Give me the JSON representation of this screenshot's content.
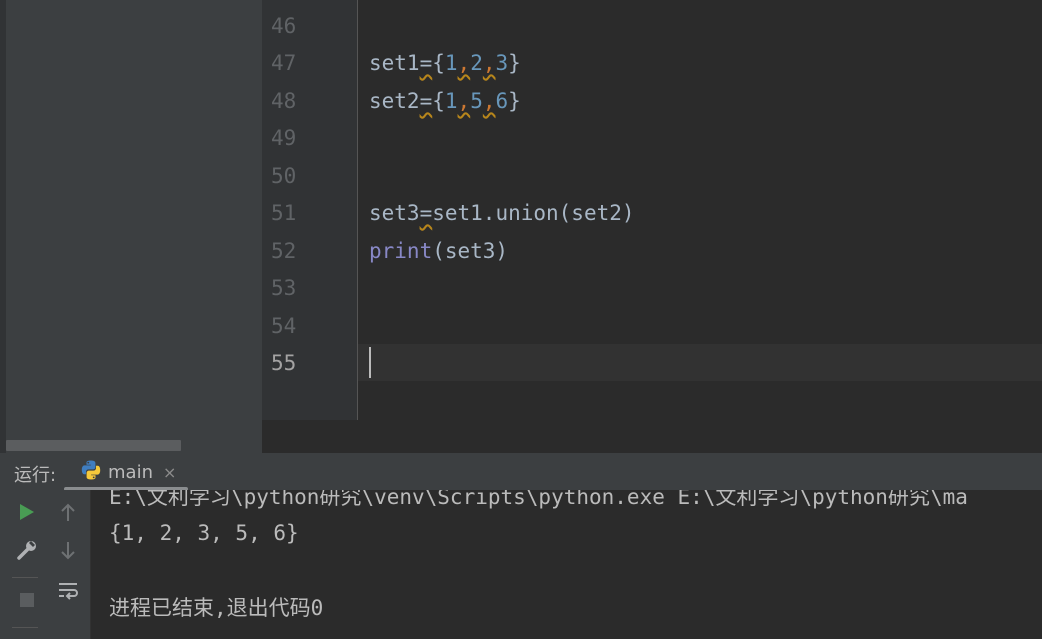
{
  "editor": {
    "line_numbers": [
      "46",
      "47",
      "48",
      "49",
      "50",
      "51",
      "52",
      "53",
      "54",
      "55"
    ],
    "current_line": "55",
    "code": {
      "l47": {
        "var": "set1",
        "eq": "=",
        "open": "{",
        "n1": "1",
        "c1": ",",
        "n2": "2",
        "c2": ",",
        "n3": "3",
        "close": "}"
      },
      "l48": {
        "var": "set2",
        "eq": "=",
        "open": "{",
        "n1": "1",
        "c1": ",",
        "n2": "5",
        "c2": ",",
        "n3": "6",
        "close": "}"
      },
      "l51": {
        "var": "set3",
        "eq": "=",
        "rest": "set1.union(set2)"
      },
      "l52": {
        "fn": "print",
        "rest": "(set3)"
      }
    }
  },
  "run_panel": {
    "label": "运行:",
    "tab_name": "main",
    "tab_close": "×",
    "console": [
      "E:\\文利学习\\python研究\\venv\\Scripts\\python.exe E:\\文利学习\\python研究\\ma",
      "{1, 2, 3, 5, 6}",
      "",
      "进程已结束,退出代码0"
    ]
  },
  "colors": {
    "accent_run": "#499c54",
    "python_blue": "#3f7dbf",
    "python_yellow": "#f5c93b"
  },
  "icons": [
    "run-icon",
    "rerun-up-icon",
    "wrench-icon",
    "scroll-down-icon",
    "stop-icon",
    "soft-wrap-icon",
    "python-icon",
    "close-icon"
  ]
}
